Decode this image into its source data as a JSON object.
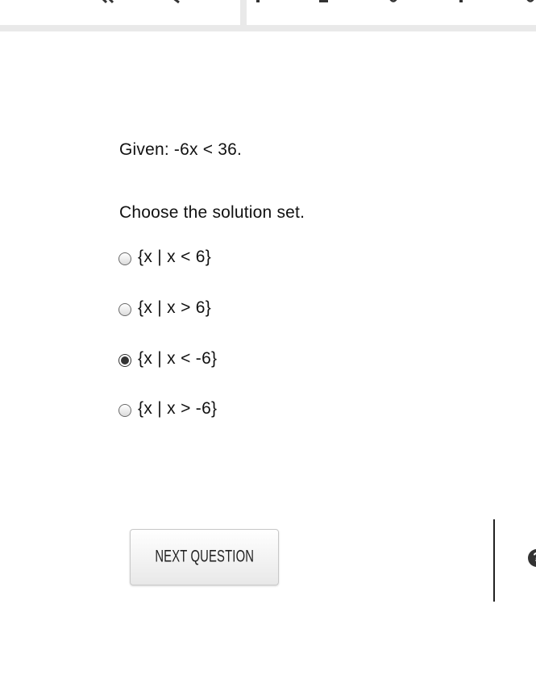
{
  "question": {
    "prompt": "Given: -6x < 36.",
    "instruction": "Choose the solution set."
  },
  "options": [
    {
      "label": "{x | x < 6}",
      "selected": false
    },
    {
      "label": "{x | x > 6}",
      "selected": false
    },
    {
      "label": "{x | x < -6}",
      "selected": true
    },
    {
      "label": "{x | x > -6}",
      "selected": false
    }
  ],
  "actions": {
    "next_label": "NEXT QUESTION",
    "help_label": "?"
  },
  "toolbar": {
    "icons": [
      "double-chevron-left-icon",
      "search-icon",
      "toolbar-icon-3",
      "toolbar-icon-4",
      "toolbar-icon-5",
      "toolbar-icon-6",
      "toolbar-icon-7"
    ]
  },
  "colors": {
    "toolbar_border": "#e9e9e9",
    "text": "#111111",
    "button_bg": "#efefef"
  }
}
